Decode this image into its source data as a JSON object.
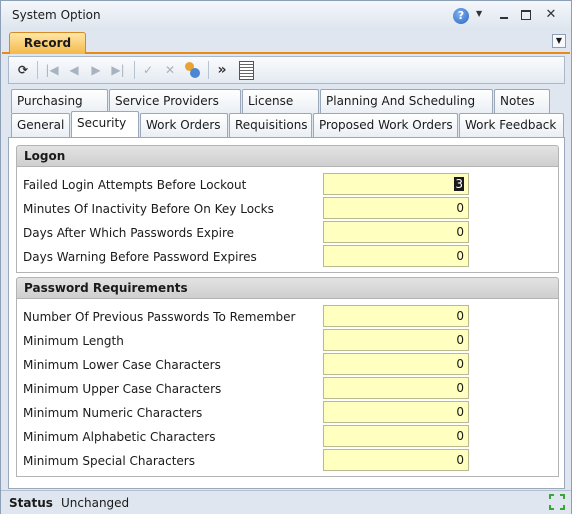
{
  "window": {
    "title": "System Option",
    "help_glyph": "?",
    "caret_glyph": "▼",
    "close_glyph": "✕"
  },
  "record_tab": {
    "label": "Record"
  },
  "toolbar": {
    "refresh_glyph": "⟳",
    "first_glyph": "|◀",
    "prev_glyph": "◀",
    "next_glyph": "▶",
    "last_glyph": "▶|",
    "check_glyph": "✓",
    "cancel_glyph": "✕",
    "more_glyph": "»"
  },
  "tabs_row1": [
    {
      "label": "Purchasing"
    },
    {
      "label": "Service Providers"
    },
    {
      "label": "License"
    },
    {
      "label": "Planning And Scheduling"
    },
    {
      "label": "Notes"
    }
  ],
  "tabs_row2": [
    {
      "label": "General"
    },
    {
      "label": "Security"
    },
    {
      "label": "Work Orders"
    },
    {
      "label": "Requisitions"
    },
    {
      "label": "Proposed Work Orders"
    },
    {
      "label": "Work Feedback"
    }
  ],
  "active_tab": "Security",
  "logon": {
    "header": "Logon",
    "rows": [
      {
        "label": "Failed Login Attempts Before Lockout",
        "value": "3"
      },
      {
        "label": "Minutes Of Inactivity Before On Key Locks",
        "value": "0"
      },
      {
        "label": "Days After Which Passwords Expire",
        "value": "0"
      },
      {
        "label": "Days Warning Before Password Expires",
        "value": "0"
      }
    ]
  },
  "password": {
    "header": "Password Requirements",
    "rows": [
      {
        "label": "Number Of Previous Passwords To Remember",
        "value": "0"
      },
      {
        "label": "Minimum Length",
        "value": "0"
      },
      {
        "label": "Minimum Lower Case Characters",
        "value": "0"
      },
      {
        "label": "Minimum Upper Case Characters",
        "value": "0"
      },
      {
        "label": "Minimum Numeric Characters",
        "value": "0"
      },
      {
        "label": "Minimum Alphabetic Characters",
        "value": "0"
      },
      {
        "label": "Minimum Special Characters",
        "value": "0"
      }
    ]
  },
  "status": {
    "label": "Status",
    "value": "Unchanged"
  },
  "colors": {
    "accent_orange": "#f4b94a",
    "field_yellow": "#ffffc0",
    "resize_green": "#3aa63a"
  }
}
